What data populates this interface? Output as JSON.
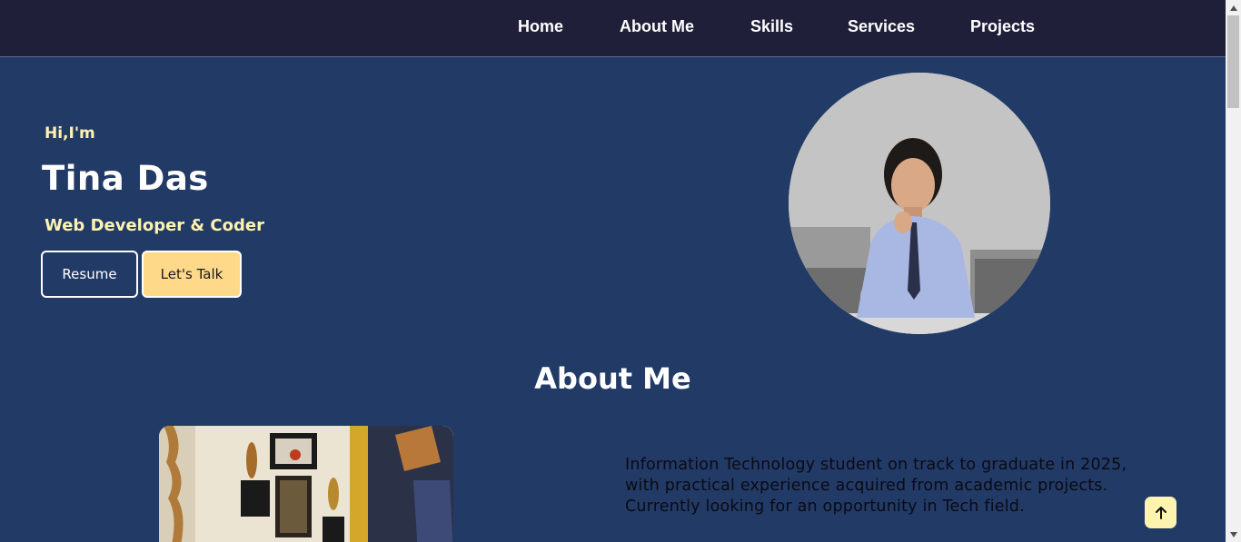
{
  "nav": {
    "items": [
      {
        "label": "Home"
      },
      {
        "label": "About Me"
      },
      {
        "label": "Skills"
      },
      {
        "label": "Services"
      },
      {
        "label": "Projects"
      }
    ]
  },
  "hero": {
    "greeting": "Hi,I'm",
    "name": "Tina Das",
    "role": "Web Developer & Coder",
    "resume_label": "Resume",
    "talk_label": "Let's Talk"
  },
  "about": {
    "title": "About Me",
    "text": "Information Technology student on track to graduate in 2025, with practical experience acquired from academic projects. Currently looking for an opportunity in Tech field."
  },
  "icons": {
    "scroll_top": "arrow-up-icon"
  },
  "colors": {
    "navbar_bg": "#1f1f3a",
    "page_bg": "#223a66",
    "accent_yellow": "#fff3b0",
    "button_talk_bg": "#ffd98a"
  }
}
